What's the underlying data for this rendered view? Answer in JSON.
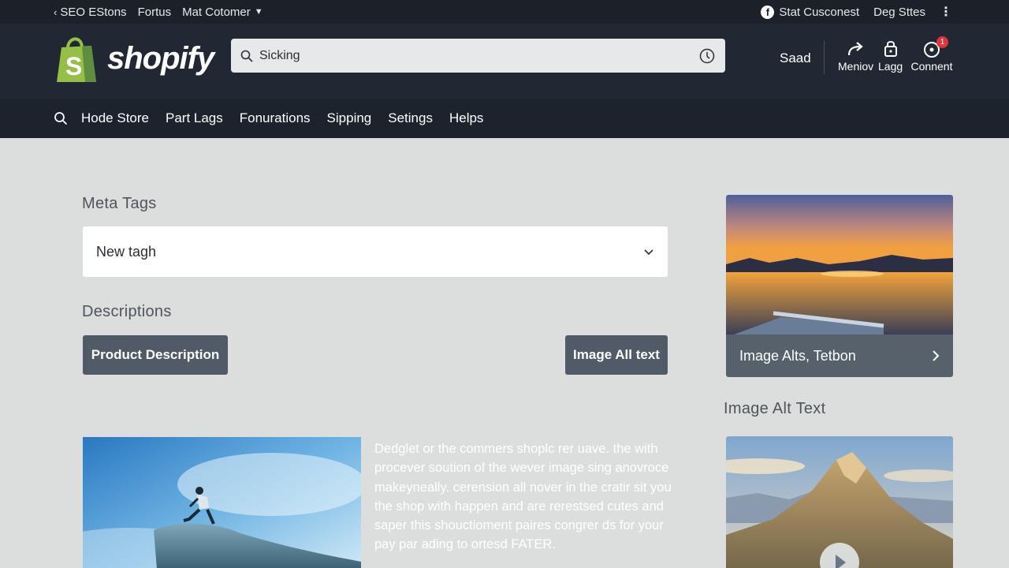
{
  "topbar": {
    "back_link": "SEO EStons",
    "link_fortus": "Fortus",
    "dropdown": "Mat Cotomer",
    "right_item1": "Stat Cusconest",
    "right_item2": "Deg Sttes"
  },
  "header": {
    "logo_text": "shopify",
    "search_value": "Sicking",
    "user": "Saad",
    "icons": [
      {
        "label": "Meniov",
        "icon": "forward-arrow-icon"
      },
      {
        "label": "Lagg",
        "icon": "bag-lock-icon"
      },
      {
        "label": "Connent",
        "icon": "notification-icon",
        "badge": "1"
      }
    ]
  },
  "nav": {
    "items": [
      "Hode Store",
      "Part Lags",
      "Fonurations",
      "Sipping",
      "Setings",
      "Helps"
    ]
  },
  "main": {
    "meta_tags_label": "Meta Tags",
    "meta_select_value": "New tagh",
    "descriptions_label": "Descriptions",
    "product_description_button": "Product Description",
    "image_alt_button": "Image All text",
    "paragraph": "Dedglet or the commers shoplc rer uave. the with procever soution of the wever image sing anovroce makeyneally. cerension all nover in the cratir sit you the shop with happen and are rerestsed cutes and saper this shouctioment paires congrer ds for your pay par ading to ortesd FATER."
  },
  "sidebar": {
    "card1_title": "Image Alts, Tetbon",
    "image_alt_text_label": "Image Alt Text"
  },
  "colors": {
    "topbar_bg": "#1b2029",
    "header_bg": "#222833",
    "nav_bg": "#1d232d",
    "page_bg": "#dcdddd",
    "button_bg": "#505b67",
    "brand_green": "#95bf47",
    "badge_red": "#e0333b"
  }
}
